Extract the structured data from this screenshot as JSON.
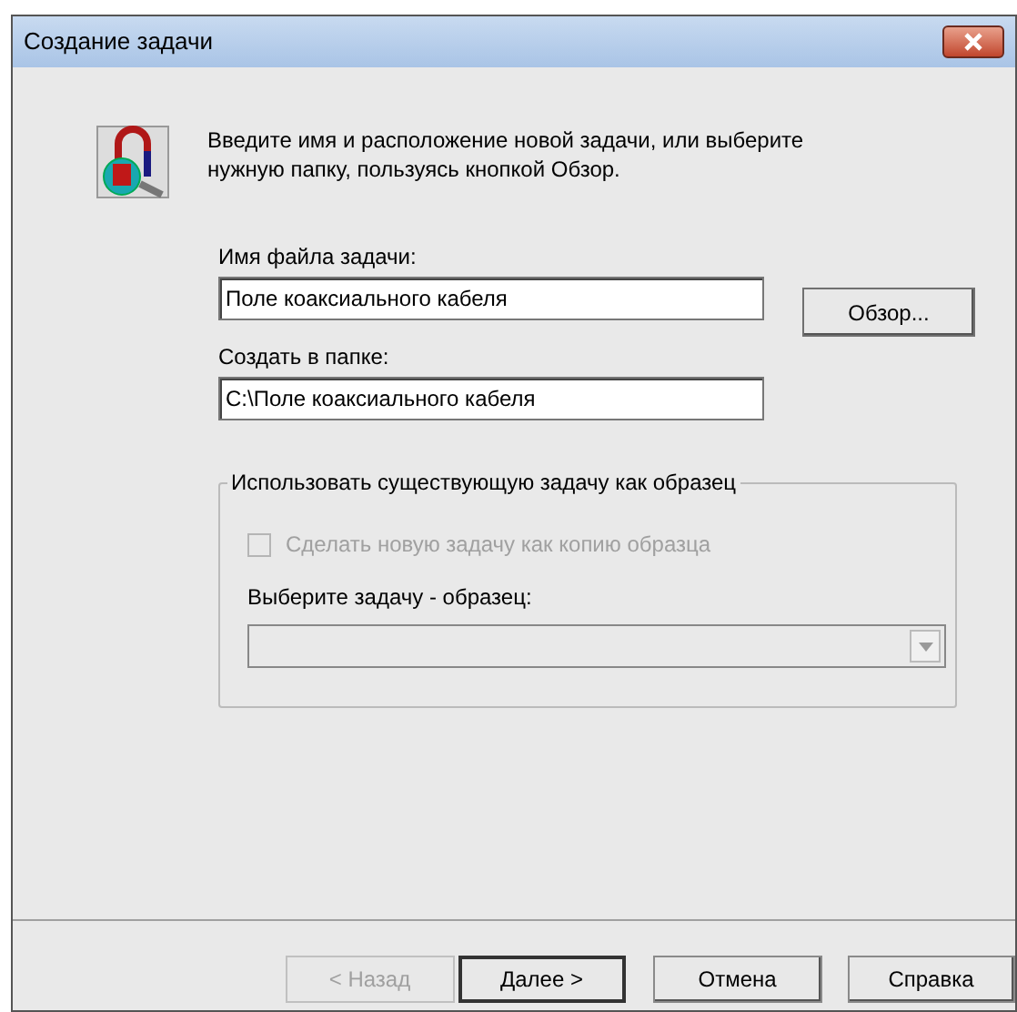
{
  "window": {
    "title": "Создание задачи"
  },
  "intro": "Введите имя и расположение новой задачи, или выберите нужную папку, пользуясь кнопкой Обзор.",
  "fields": [
    {
      "label": "Имя файла задачи:",
      "value": "Поле коаксиального кабеля"
    },
    {
      "label": "Создать в папке:",
      "value": "C:\\Поле коаксиального кабеля"
    }
  ],
  "browse_button": "Обзор...",
  "template_group": {
    "title": "Использовать существующую задачу как образец",
    "checkbox": {
      "label": "Сделать новую задачу как копию образца",
      "checked": false,
      "disabled": true
    },
    "select_label": "Выберите задачу - образец:",
    "select_disabled": true
  },
  "buttons": [
    {
      "label": "< Назад",
      "disabled": true,
      "default": false
    },
    {
      "label": "Далее >",
      "disabled": false,
      "default": true
    },
    {
      "label": "Отмена",
      "disabled": false,
      "default": false
    },
    {
      "label": "Справка",
      "disabled": false,
      "default": false
    }
  ]
}
